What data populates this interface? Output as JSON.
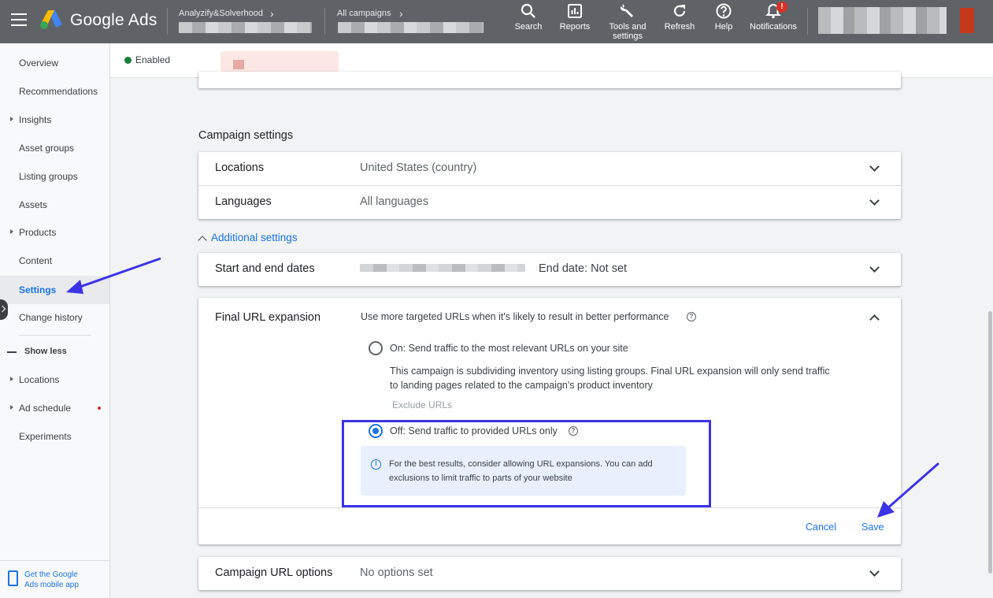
{
  "header": {
    "brand": "Google Ads",
    "account_crumb": "Analyzify&Solverhood",
    "campaign_crumb": "All campaigns",
    "tools": [
      {
        "label": "Search",
        "icon": "search-icon"
      },
      {
        "label": "Reports",
        "icon": "reports-icon"
      },
      {
        "label": "Tools and settings",
        "icon": "wrench-icon"
      },
      {
        "label": "Refresh",
        "icon": "refresh-icon"
      },
      {
        "label": "Help",
        "icon": "help-icon"
      },
      {
        "label": "Notifications",
        "icon": "bell-icon"
      }
    ],
    "notification_badge": "!"
  },
  "sidebar": {
    "items": [
      {
        "label": "Overview"
      },
      {
        "label": "Recommendations"
      },
      {
        "label": "Insights"
      },
      {
        "label": "Asset groups"
      },
      {
        "label": "Listing groups"
      },
      {
        "label": "Assets"
      },
      {
        "label": "Products"
      },
      {
        "label": "Content"
      },
      {
        "label": "Settings"
      },
      {
        "label": "Change history"
      }
    ],
    "show_less": "Show less",
    "more_items": [
      {
        "label": "Locations"
      },
      {
        "label": "Ad schedule"
      },
      {
        "label": "Experiments"
      }
    ],
    "mobile_app_line1": "Get the Google",
    "mobile_app_line2": "Ads mobile app"
  },
  "status": {
    "label": "Enabled",
    "color": "#188038"
  },
  "campaign_settings": {
    "title": "Campaign settings",
    "locations": {
      "label": "Locations",
      "value": "United States (country)"
    },
    "languages": {
      "label": "Languages",
      "value": "All languages"
    }
  },
  "additional_settings": {
    "label": "Additional settings",
    "dates": {
      "label": "Start and end dates",
      "end_date": "End date: Not set"
    },
    "final_url": {
      "label": "Final URL expansion",
      "description": "Use more targeted URLs when it's likely to result in better performance",
      "option_on": "On: Send traffic to the most relevant URLs on your site",
      "on_detail_line1": "This campaign is subdividing inventory using listing groups. Final URL expansion will only send traffic",
      "on_detail_line2": "to landing pages related to the campaign's product inventory",
      "exclude_urls": "Exclude URLs",
      "option_off": "Off: Send traffic to provided URLs only",
      "info_text": "For the best results, consider allowing URL expansions. You can add exclusions to limit traffic to parts of your website",
      "cancel": "Cancel",
      "save": "Save"
    },
    "url_options": {
      "label": "Campaign URL options",
      "value": "No options set"
    }
  },
  "colors": {
    "accent": "#1a73e8",
    "annotation": "#3b33e8",
    "topbar": "#5f6368"
  }
}
